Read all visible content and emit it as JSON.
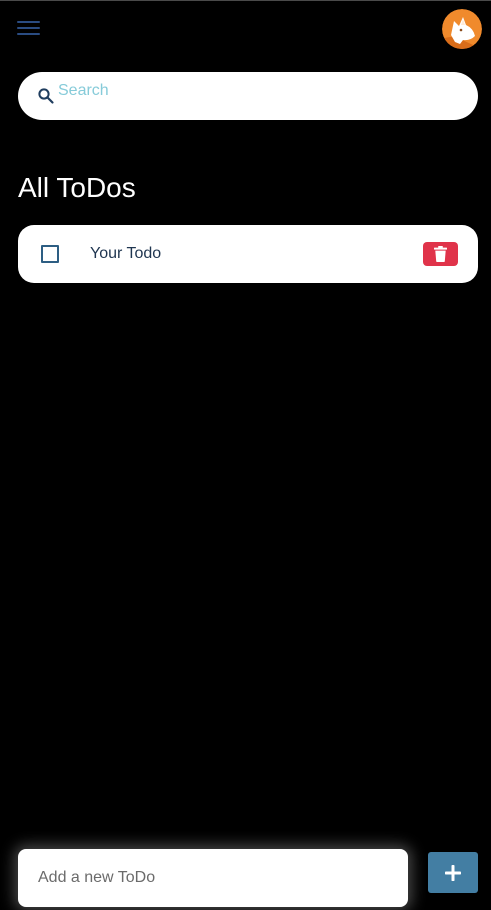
{
  "header": {
    "menu_icon": "hamburger-menu-icon",
    "avatar_icon": "fox-avatar"
  },
  "search": {
    "icon": "search-icon",
    "placeholder": "Search",
    "value": ""
  },
  "main": {
    "title": "All ToDos",
    "todos": [
      {
        "text": "Your Todo",
        "checked": false,
        "delete_icon": "trash-icon"
      }
    ]
  },
  "footer": {
    "new_todo_placeholder": "Add a new ToDo",
    "add_icon": "plus-icon"
  },
  "colors": {
    "background": "#000000",
    "menu": "#2a4c82",
    "search_placeholder": "#86cbd9",
    "checkbox": "#2d5e83",
    "todo_text": "#1f3550",
    "delete": "#e0334a",
    "add_button": "#437ea3",
    "avatar": "#f08a2c"
  }
}
